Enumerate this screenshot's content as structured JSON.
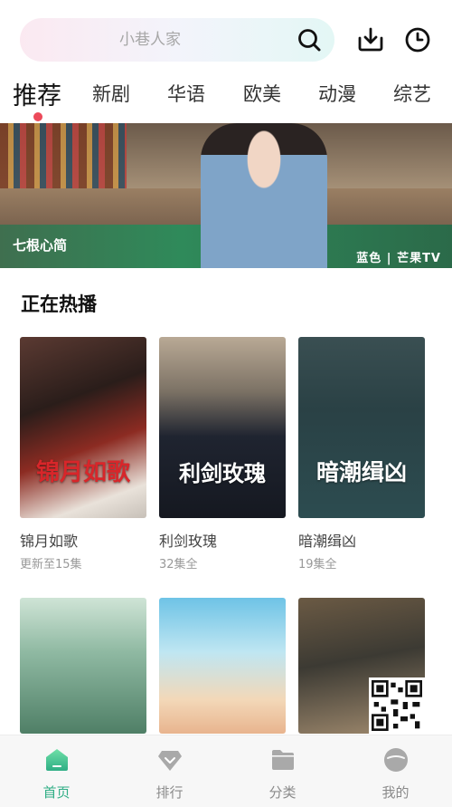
{
  "search": {
    "placeholder": "小巷人家",
    "icon": "search-icon"
  },
  "header_icons": [
    "download-icon",
    "history-icon"
  ],
  "tabs": [
    {
      "label": "推荐",
      "active": true
    },
    {
      "label": "新剧",
      "active": false
    },
    {
      "label": "华语",
      "active": false
    },
    {
      "label": "欧美",
      "active": false
    },
    {
      "label": "动漫",
      "active": false
    },
    {
      "label": "综艺",
      "active": false
    }
  ],
  "banner": {
    "title": "七根心简",
    "brand": "蓝色 | 芒果TV"
  },
  "section": {
    "title": "正在热播"
  },
  "shows": [
    {
      "title": "锦月如歌",
      "status": "更新至15集",
      "poster_text": "锦月如歌"
    },
    {
      "title": "利剑玫瑰",
      "status": "32集全",
      "poster_text": "利剑玫瑰"
    },
    {
      "title": "暗潮缉凶",
      "status": "19集全",
      "poster_text": "暗潮缉凶"
    }
  ],
  "shows_row2": [
    {
      "title": "",
      "poster": "green-landscape"
    },
    {
      "title": "",
      "poster": "youth-group"
    },
    {
      "title": "",
      "poster": "crowd-scene"
    }
  ],
  "bottom_nav": [
    {
      "label": "首页",
      "icon": "home-icon",
      "active": true
    },
    {
      "label": "排行",
      "icon": "ranking-icon",
      "active": false
    },
    {
      "label": "分类",
      "icon": "category-folder-icon",
      "active": false
    },
    {
      "label": "我的",
      "icon": "profile-icon",
      "active": false
    }
  ],
  "colors": {
    "accent": "#2fae85",
    "tab_dot": "#ec4a5a"
  }
}
